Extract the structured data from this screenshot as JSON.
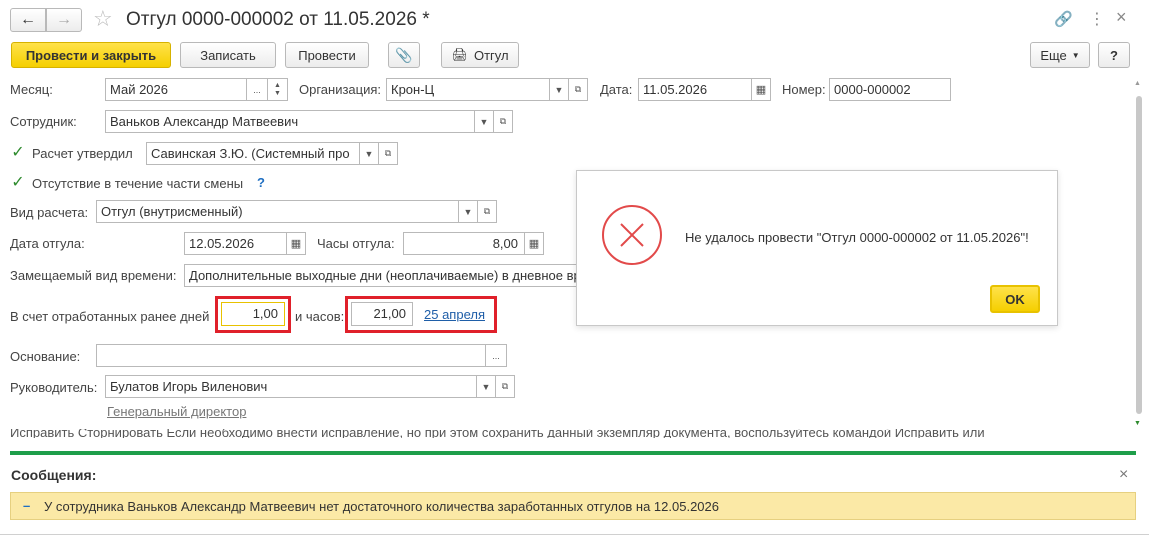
{
  "window": {
    "title": "Отгул 0000-000002 от 11.05.2026 *",
    "menu_icon": "more-vertical-icon"
  },
  "toolbar": {
    "post_close_label": "Провести и закрыть",
    "save_label": "Записать",
    "post_label": "Провести",
    "print_label": "Отгул",
    "more_label": "Еще",
    "help_label": "?"
  },
  "form": {
    "month_label": "Месяц:",
    "month_value": "Май 2026",
    "org_label": "Организация:",
    "org_value": "Крон-Ц",
    "date_label": "Дата:",
    "date_value": "11.05.2026",
    "number_label": "Номер:",
    "number_value": "0000-000002",
    "employee_label": "Сотрудник:",
    "employee_value": "Ваньков Александр Матвеевич",
    "approved_label": "Расчет утвердил",
    "approved_value": "Савинская З.Ю. (Системный про",
    "partial_label": "Отсутствие в течение части смены",
    "partial_help": "?",
    "calc_type_label": "Вид расчета:",
    "calc_type_value": "Отгул (внутрисменный)",
    "off_date_label": "Дата отгула:",
    "off_date_value": "12.05.2026",
    "off_hours_label": "Часы отгула:",
    "off_hours_value": "8,00",
    "replaced_label": "Замещаемый вид времени:",
    "replaced_value": "Дополнительные выходные дни (неоплачиваемые) в дневное время",
    "worked_days_label": "В счет отработанных ранее дней",
    "worked_days_value": "1,00",
    "hours_label": "и часов:",
    "hours_value": "21,00",
    "date_link": "25 апреля",
    "basis_label": "Основание:",
    "basis_value": "",
    "head_label": "Руководитель:",
    "head_value": "Булатов Игорь Виленович",
    "head_position": "Генеральный директор",
    "footer_note": "Исправить   Сторнировать   Если необходимо внести исправление, но при этом сохранить данный экземпляр документа, воспользуйтесь командой Исправить или"
  },
  "dialog": {
    "message": "Не удалось провести \"Отгул 0000-000002 от 11.05.2026\"!",
    "ok_label": "OK",
    "icon": "error-icon"
  },
  "messages": {
    "title": "Сообщения:",
    "close": "×",
    "item": "У сотрудника Ваньков Александр Матвеевич нет достаточного количества заработанных отгулов на 12.05.2026",
    "bullet": "–"
  },
  "colors": {
    "accent_yellow": "#f5cf00",
    "green_bar": "#1e9e4a",
    "error_red": "#e0202a",
    "message_bg": "#fbe9a6"
  }
}
